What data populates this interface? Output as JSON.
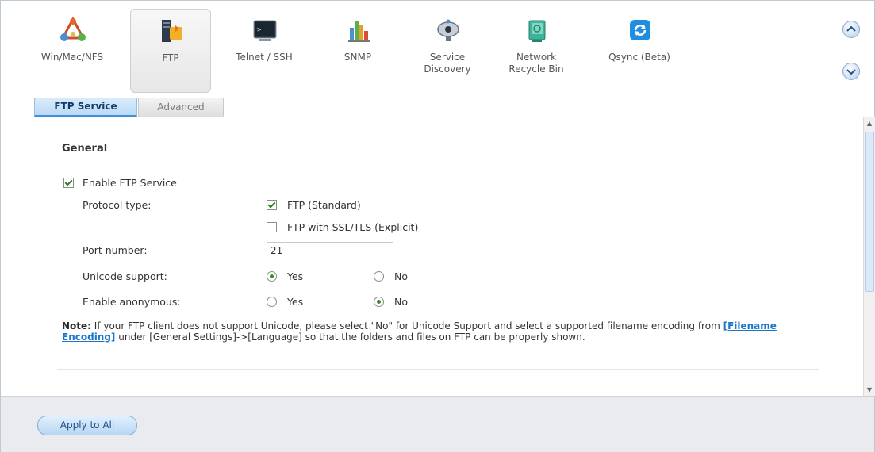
{
  "apps": [
    {
      "label": "Win/Mac/NFS",
      "icon": "network-share-icon"
    },
    {
      "label": "FTP",
      "icon": "ftp-server-icon"
    },
    {
      "label": "Telnet / SSH",
      "icon": "terminal-icon"
    },
    {
      "label": "SNMP",
      "icon": "bar-chart-icon"
    },
    {
      "label": "Service\nDiscovery",
      "icon": "satellite-dish-icon"
    },
    {
      "label": "Network\nRecycle Bin",
      "icon": "recycle-bin-icon"
    },
    {
      "label": "Qsync (Beta)",
      "icon": "sync-icon"
    }
  ],
  "tabs": {
    "active": "FTP Service",
    "inactive": "Advanced"
  },
  "general": {
    "title": "General",
    "enable_ftp_label": "Enable FTP Service",
    "enable_ftp_checked": true,
    "protocol_label": "Protocol type:",
    "protocol_ftp_label": "FTP (Standard)",
    "protocol_ftp_checked": true,
    "protocol_ssl_label": "FTP with SSL/TLS (Explicit)",
    "protocol_ssl_checked": false,
    "port_label": "Port number:",
    "port_value": "21",
    "unicode_label": "Unicode support:",
    "unicode_yes": "Yes",
    "unicode_no": "No",
    "unicode_selected": "Yes",
    "anonymous_label": "Enable anonymous:",
    "anonymous_yes": "Yes",
    "anonymous_no": "No",
    "anonymous_selected": "No"
  },
  "note": {
    "prefix": "Note:",
    "text1": " If your FTP client does not support Unicode, please select \"No\" for Unicode Support and select a supported filename encoding from ",
    "link": "[Filename Encoding]",
    "text2": " under [General Settings]->[Language] so that the folders and files on FTP can be properly shown."
  },
  "footer": {
    "apply_label": "Apply to All"
  },
  "colors": {
    "accent": "#3d8fd9",
    "link": "#1a77c9",
    "check": "#2f7a1f"
  }
}
